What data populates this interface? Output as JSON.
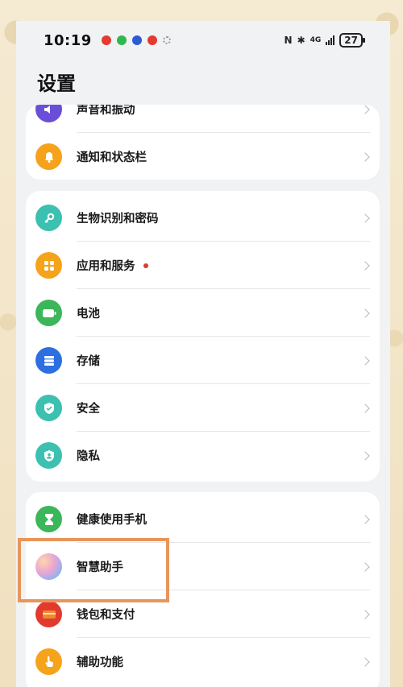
{
  "status_bar": {
    "time": "10:19",
    "network": "4G",
    "battery": "27"
  },
  "page": {
    "title": "设置"
  },
  "groups": [
    {
      "items": [
        {
          "label": "声音和振动",
          "icon": "speaker-icon",
          "color": "#6b4ed8"
        },
        {
          "label": "通知和状态栏",
          "icon": "bell-icon",
          "color": "#f5a31a"
        }
      ]
    },
    {
      "items": [
        {
          "label": "生物识别和密码",
          "icon": "key-icon",
          "color": "#3cc0b0"
        },
        {
          "label": "应用和服务",
          "icon": "apps-icon",
          "color": "#f5a31a",
          "badge": true
        },
        {
          "label": "电池",
          "icon": "battery-icon",
          "color": "#3cb65a"
        },
        {
          "label": "存储",
          "icon": "storage-icon",
          "color": "#2c6fe0"
        },
        {
          "label": "安全",
          "icon": "shield-check-icon",
          "color": "#3cc0b0"
        },
        {
          "label": "隐私",
          "icon": "privacy-shield-icon",
          "color": "#3cc0b0"
        }
      ]
    },
    {
      "items": [
        {
          "label": "健康使用手机",
          "icon": "hourglass-icon",
          "color": "#3cb65a"
        },
        {
          "label": "智慧助手",
          "icon": "assistant-orb-icon",
          "color": "#c9a4e8"
        },
        {
          "label": "钱包和支付",
          "icon": "wallet-icon",
          "color": "#e23a2e"
        },
        {
          "label": "辅助功能",
          "icon": "hand-icon",
          "color": "#f5a31a"
        }
      ]
    }
  ],
  "highlight_color": "#e8955a"
}
